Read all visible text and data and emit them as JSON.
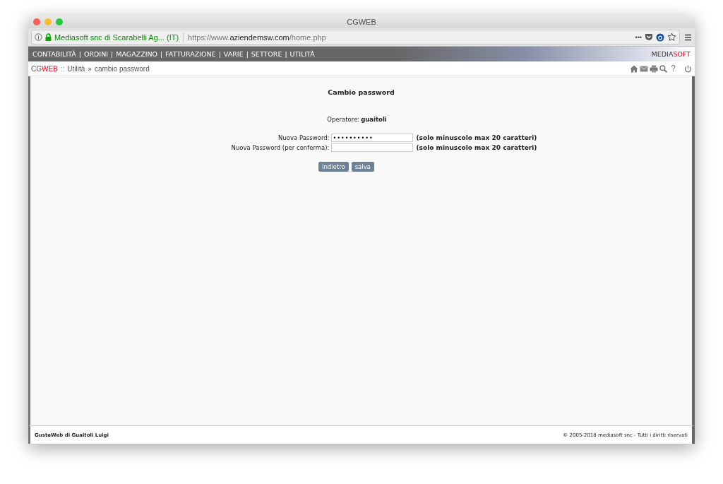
{
  "window": {
    "title": "CGWEB"
  },
  "address_bar": {
    "identity": "Mediasoft snc di Scarabelli Ag... (IT)",
    "url_prefix": "https://www.",
    "url_domain": "aziendemsw.com",
    "url_path": "/home.php",
    "more": "•••"
  },
  "menu": {
    "items": [
      {
        "label": "CONTABILITÀ"
      },
      {
        "label": "ORDINI"
      },
      {
        "label": "MAGAZZINO"
      },
      {
        "label": "FATTURAZIONE"
      },
      {
        "label": "VARIE"
      },
      {
        "label": "SETTORE"
      },
      {
        "label": "UTILITÀ"
      }
    ],
    "separator": "|",
    "brand": {
      "prefix": "MEDIA",
      "accent": "SOFT"
    }
  },
  "breadcrumb": {
    "brand": {
      "prefix": "CG",
      "accent": "WEB"
    },
    "sep1": "::",
    "section": "Utilità",
    "sep2": "»",
    "page": "cambio password",
    "help": "?"
  },
  "form": {
    "title": "Cambio password",
    "operator_label": "Operatore:",
    "operator": "guaitoli",
    "fields": [
      {
        "label": "Nuova Password:",
        "value": "••••••••••",
        "hint": "(solo minuscolo max 20 caratteri)"
      },
      {
        "label": "Nuova Password (per conferma):",
        "hint": "(solo minuscolo max 20 caratteri)"
      }
    ],
    "buttons": [
      "indietro",
      "salva"
    ]
  },
  "footer": {
    "left": "GustaWeb di Guaitoli Luigi",
    "right": "© 2005-2018 mediasoft snc - Tutti i diritti riservati"
  }
}
